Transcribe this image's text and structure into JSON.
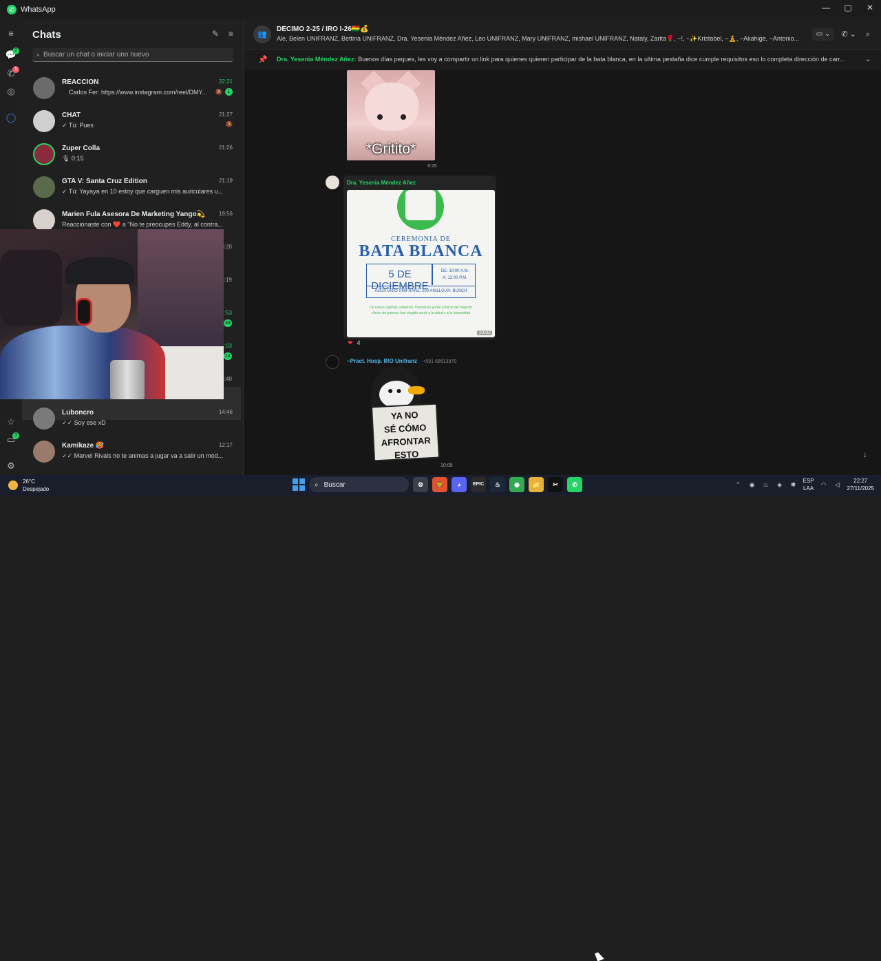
{
  "window": {
    "title": "WhatsApp",
    "controls": [
      "—",
      "▢",
      "✕"
    ]
  },
  "sidebar": {
    "chats_badge": "2",
    "calls_badge": "1"
  },
  "chatlist": {
    "title": "Chats",
    "search_placeholder": "Buscar un chat o iniciar uno nuevo",
    "items": [
      {
        "name": "REACCION",
        "time": "22:21",
        "preview": "Carlos Fer: https://www.instagram.com/reel/DMY...",
        "unread": "1"
      },
      {
        "name": "CHAT",
        "time": "21:27",
        "preview": "✓ Tú: Pues"
      },
      {
        "name": "Zuper Colla",
        "time": "21:26",
        "preview": "🎙 0:15"
      },
      {
        "name": "GTA V: Santa Cruz Edition",
        "time": "21:19",
        "preview": "✓ Tú: Yayaya en 10 estoy que carguen mis auriculares u..."
      },
      {
        "name": "Marien Fula Asesora De Marketing Yango💫",
        "time": "19:56",
        "preview": "Reaccionaste con ❤️ a \"No te preocupes Eddy, al contra..."
      },
      {
        "name": "Luboncro",
        "time": "14:46",
        "preview": "✓✓ Soy ese xD"
      },
      {
        "name": "Kamikaze 🥵",
        "time": "12:17",
        "preview": "✓✓ Marvel Rivals no te animas a jugar va a salir un mod..."
      }
    ],
    "partial_times": [
      "18:20",
      "18:19",
      "17:53",
      "17:03",
      "16:40"
    ],
    "partial_badges": [
      "48",
      "14"
    ]
  },
  "conversation": {
    "title": "DECIMO 2-25 / IRO I-26🇧🇴💰",
    "members": "Ale, Belen UNIFRANZ, Bettina UNIFRANZ, Dra. Yesenia Méndez Añez, Leo UNIFRANZ, Mary UNIFRANZ, mishael UNIFRANZ, Nataly, Zarita🌹, ~!, ~✨Kristabel, ~🧘, ~Akahige, ~Antonio...",
    "pinned_author": "Dra. Yesenia Méndez Añez:",
    "pinned_text": "Buenos días peques, les voy a compartir un link para quienes quieren participar de la bata blanca, en la ultima pestaña dice cumple requisitos eso lo completa dirección de carr...",
    "sticker1": {
      "caption": "*Gritito*",
      "time": "9:25"
    },
    "message_image": {
      "sender": "Dra. Yesenia Méndez Añez",
      "poster_line1": "CEREMONIA DE",
      "poster_line2": "BATA BLANCA",
      "poster_date": "5 DE DICIEMBRE",
      "poster_hours_1": "DE: 10:00 A.M.",
      "poster_hours_2": "A: 12:00 P.M.",
      "poster_place": "AUDITORIO UNIFRANZ, 200 ANILLO AV. BUSCH",
      "poster_small": "Un nuevo capítulo comienza. Honramos portar el inicio del trayecto clínico de quienes han elegido servir a la salud y a la humanidad",
      "time": "10:02",
      "reaction_count": "4"
    },
    "message_sticker2": {
      "sender": "~Pract. Hosp. IRO Unifranz",
      "phone": "+591 68613970",
      "sign_text": [
        "YA NO",
        "SÉ CÓMO",
        "AFRONTAR",
        "ESTO"
      ],
      "time": "10:09"
    }
  },
  "taskbar": {
    "temperature": "26°C",
    "weather": "Despejado",
    "search_label": "Buscar",
    "lang_1": "ESP",
    "lang_2": "LAA",
    "clock_time": "22:27",
    "clock_date": "27/11/2025",
    "apps": [
      {
        "name": "settings",
        "label": "⚙",
        "color": "#3b3f4a"
      },
      {
        "name": "brave",
        "label": "🦁",
        "color": "#e2532d"
      },
      {
        "name": "discord",
        "label": "◕",
        "color": "#5865f2"
      },
      {
        "name": "epic",
        "label": "EPIC",
        "color": "#2a2a2a"
      },
      {
        "name": "steam",
        "label": "♨",
        "color": "#1b2838"
      },
      {
        "name": "chrome",
        "label": "◉",
        "color": "#34a853"
      },
      {
        "name": "explorer",
        "label": "📁",
        "color": "#e8b23a"
      },
      {
        "name": "capcut",
        "label": "✂",
        "color": "#111111"
      },
      {
        "name": "whatsapp",
        "label": "✆",
        "color": "#25d366"
      }
    ]
  }
}
